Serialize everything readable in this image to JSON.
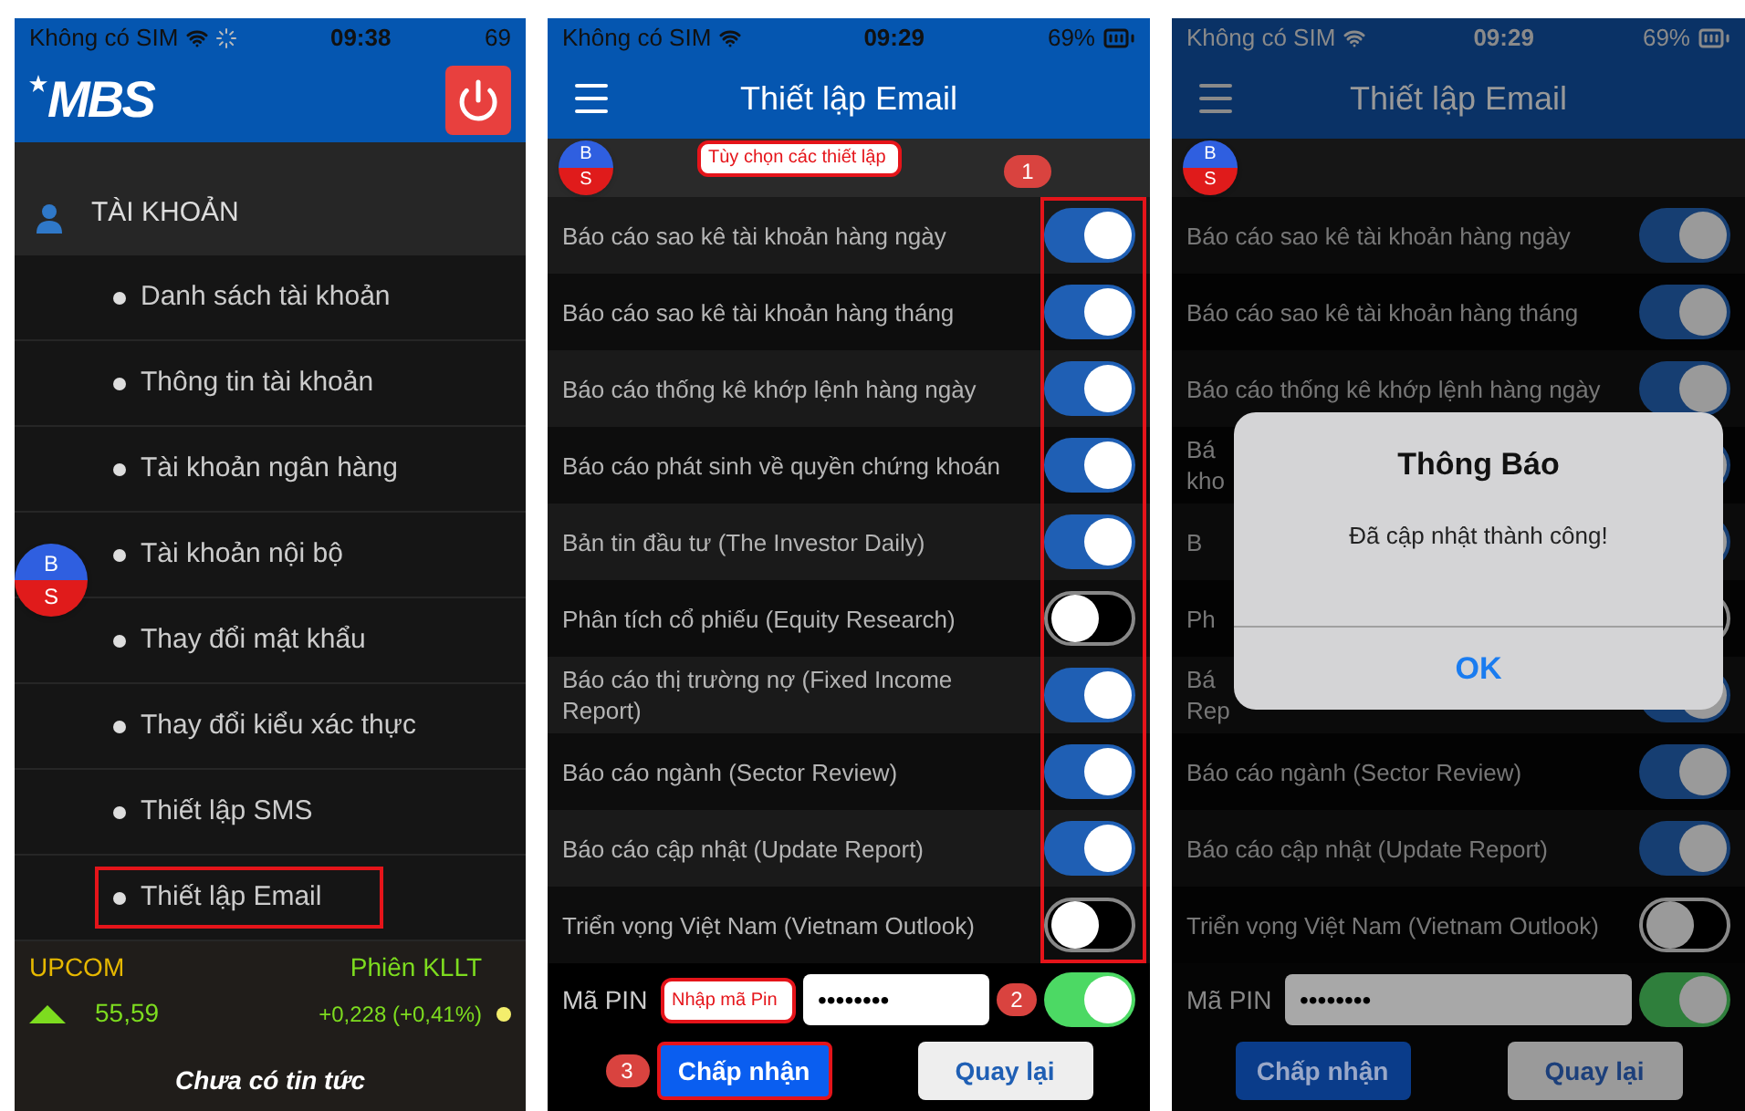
{
  "menu_screen": {
    "status_bar": {
      "carrier": "Không có SIM",
      "time": "09:38",
      "battery": "69"
    },
    "logo": "MBS",
    "bubble": {
      "top": "B",
      "bottom": "S"
    },
    "section": {
      "title": "TÀI KHOẢN"
    },
    "items": [
      {
        "label": "Danh sách tài khoản",
        "highlighted": false
      },
      {
        "label": "Thông tin tài khoản",
        "highlighted": false
      },
      {
        "label": "Tài khoản ngân hàng",
        "highlighted": false
      },
      {
        "label": "Tài khoản nội bộ",
        "highlighted": false
      },
      {
        "label": "Thay đổi mật khẩu",
        "highlighted": false
      },
      {
        "label": "Thay đổi kiểu xác thực",
        "highlighted": false
      },
      {
        "label": "Thiết lập SMS",
        "highlighted": false
      },
      {
        "label": "Thiết lập Email",
        "highlighted": true
      }
    ],
    "ticker": {
      "index": "UPCOM",
      "session": "Phiên KLLT",
      "value": "55,59",
      "change": "+0,228 (+0,41%)",
      "news": "Chưa có tin tức"
    }
  },
  "settings_screen": {
    "dimmed": false,
    "status_bar": {
      "carrier": "Không có SIM",
      "time": "09:29",
      "battery": "69%"
    },
    "title": "Thiết lập Email",
    "bubble": {
      "top": "B",
      "bottom": "S"
    },
    "options_callout": {
      "text": "Tùy chọn các thiết lập",
      "number": "1"
    },
    "options": [
      {
        "label": "Báo cáo sao kê tài khoản hàng ngày",
        "on": true
      },
      {
        "label": "Báo cáo sao kê tài khoản hàng tháng",
        "on": true
      },
      {
        "label": "Báo cáo thống kê khớp lệnh hàng ngày",
        "on": true
      },
      {
        "label": "Báo cáo phát sinh về quyền chứng khoán",
        "on": true
      },
      {
        "label": "Bản tin đầu tư (The Investor Daily)",
        "on": true
      },
      {
        "label": "Phân tích cổ phiếu (Equity Research)",
        "on": false
      },
      {
        "label": "Báo cáo thị trường nợ (Fixed Income Report)",
        "on": true
      },
      {
        "label": "Báo cáo ngành (Sector Review)",
        "on": true
      },
      {
        "label": "Báo cáo cập nhật (Update Report)",
        "on": true
      },
      {
        "label": "Triển vọng Việt Nam (Vietnam Outlook)",
        "on": false
      }
    ],
    "pin": {
      "label": "Mã PIN",
      "value": "••••••••",
      "on": true,
      "callout": "Nhập mã Pin",
      "number": "2"
    },
    "buttons": [
      {
        "label": "Chấp nhận",
        "kind": "primary",
        "highlighted": true,
        "number": "3"
      },
      {
        "label": "Quay lại",
        "kind": "secondary",
        "highlighted": false
      }
    ]
  },
  "result_screen": {
    "dimmed": true,
    "status_bar": {
      "carrier": "Không có SIM",
      "time": "09:29",
      "battery": "69%"
    },
    "title": "Thiết lập Email",
    "bubble": {
      "top": "B",
      "bottom": "S"
    },
    "options": [
      {
        "label": "Báo cáo sao kê tài khoản hàng ngày",
        "on": true,
        "kind": "full"
      },
      {
        "label": "Báo cáo sao kê tài khoản hàng tháng",
        "on": true,
        "kind": "full"
      },
      {
        "label": "Báo cáo thống kê khớp lệnh hàng ngày",
        "on": true,
        "kind": "full"
      },
      {
        "label": "Bá kho",
        "on": true,
        "kind": "covered"
      },
      {
        "label": "B",
        "on": true,
        "kind": "covered"
      },
      {
        "label": "Ph",
        "on": false,
        "kind": "covered"
      },
      {
        "label": "Bá Rep",
        "on": true,
        "kind": "covered"
      },
      {
        "label": "Báo cáo ngành (Sector Review)",
        "on": true,
        "kind": "full"
      },
      {
        "label": "Báo cáo cập nhật (Update Report)",
        "on": true,
        "kind": "full"
      },
      {
        "label": "Triển vọng Việt Nam (Vietnam Outlook)",
        "on": false,
        "kind": "full"
      }
    ],
    "pin": {
      "label": "Mã PIN",
      "value": "••••••••",
      "on": true
    },
    "buttons": [
      {
        "label": "Chấp nhận",
        "kind": "primary",
        "highlighted": false
      },
      {
        "label": "Quay lại",
        "kind": "secondary",
        "highlighted": false
      }
    ],
    "dialog": {
      "title": "Thông Báo",
      "message": "Đã cập nhật thành công!",
      "button": "OK"
    }
  }
}
